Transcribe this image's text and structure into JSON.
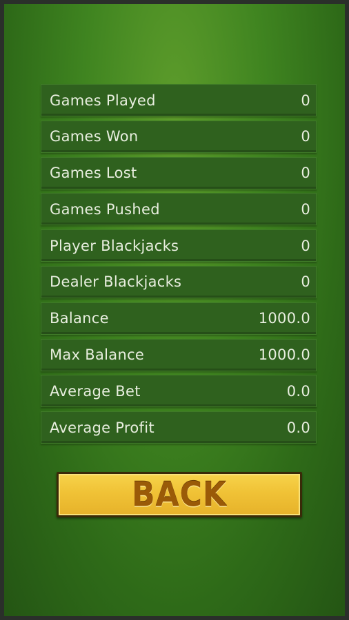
{
  "stats": [
    {
      "label": "Games Played",
      "value": "0"
    },
    {
      "label": "Games Won",
      "value": "0"
    },
    {
      "label": "Games Lost",
      "value": "0"
    },
    {
      "label": "Games Pushed",
      "value": "0"
    },
    {
      "label": "Player Blackjacks",
      "value": "0"
    },
    {
      "label": "Dealer Blackjacks",
      "value": "0"
    },
    {
      "label": "Balance",
      "value": "1000.0"
    },
    {
      "label": "Max Balance",
      "value": "1000.0"
    },
    {
      "label": "Average Bet",
      "value": "0.0"
    },
    {
      "label": "Average Profit",
      "value": "0.0"
    }
  ],
  "back_button": {
    "label": "BACK"
  },
  "colors": {
    "felt": "#3f8420",
    "row_bg": "#2f611e",
    "button_gold": "#f0c236",
    "button_text": "#9a5a08"
  }
}
